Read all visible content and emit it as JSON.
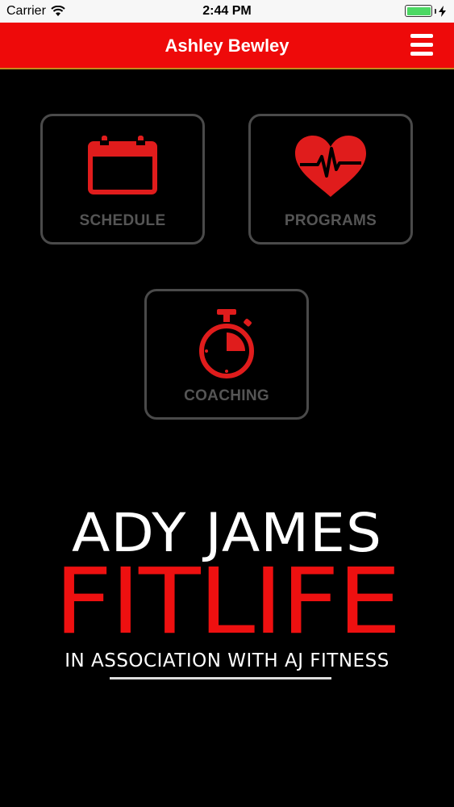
{
  "status_bar": {
    "carrier": "Carrier",
    "time": "2:44 PM",
    "battery_level": 1.0,
    "battery_color": "#4cd964"
  },
  "nav": {
    "title": "Ashley Bewley",
    "menu_icon": "hamburger-menu-icon",
    "background_color": "#ee0a0a"
  },
  "tiles": [
    {
      "label": "SCHEDULE",
      "icon": "calendar-icon"
    },
    {
      "label": "PROGRAMS",
      "icon": "heart-pulse-icon"
    },
    {
      "label": "COACHING",
      "icon": "stopwatch-icon"
    }
  ],
  "logo": {
    "line1": "ADY JAMES",
    "line2": "FITLIFE",
    "line3": "IN ASSOCIATION WITH AJ FITNESS",
    "accent_color": "#ee1010"
  }
}
